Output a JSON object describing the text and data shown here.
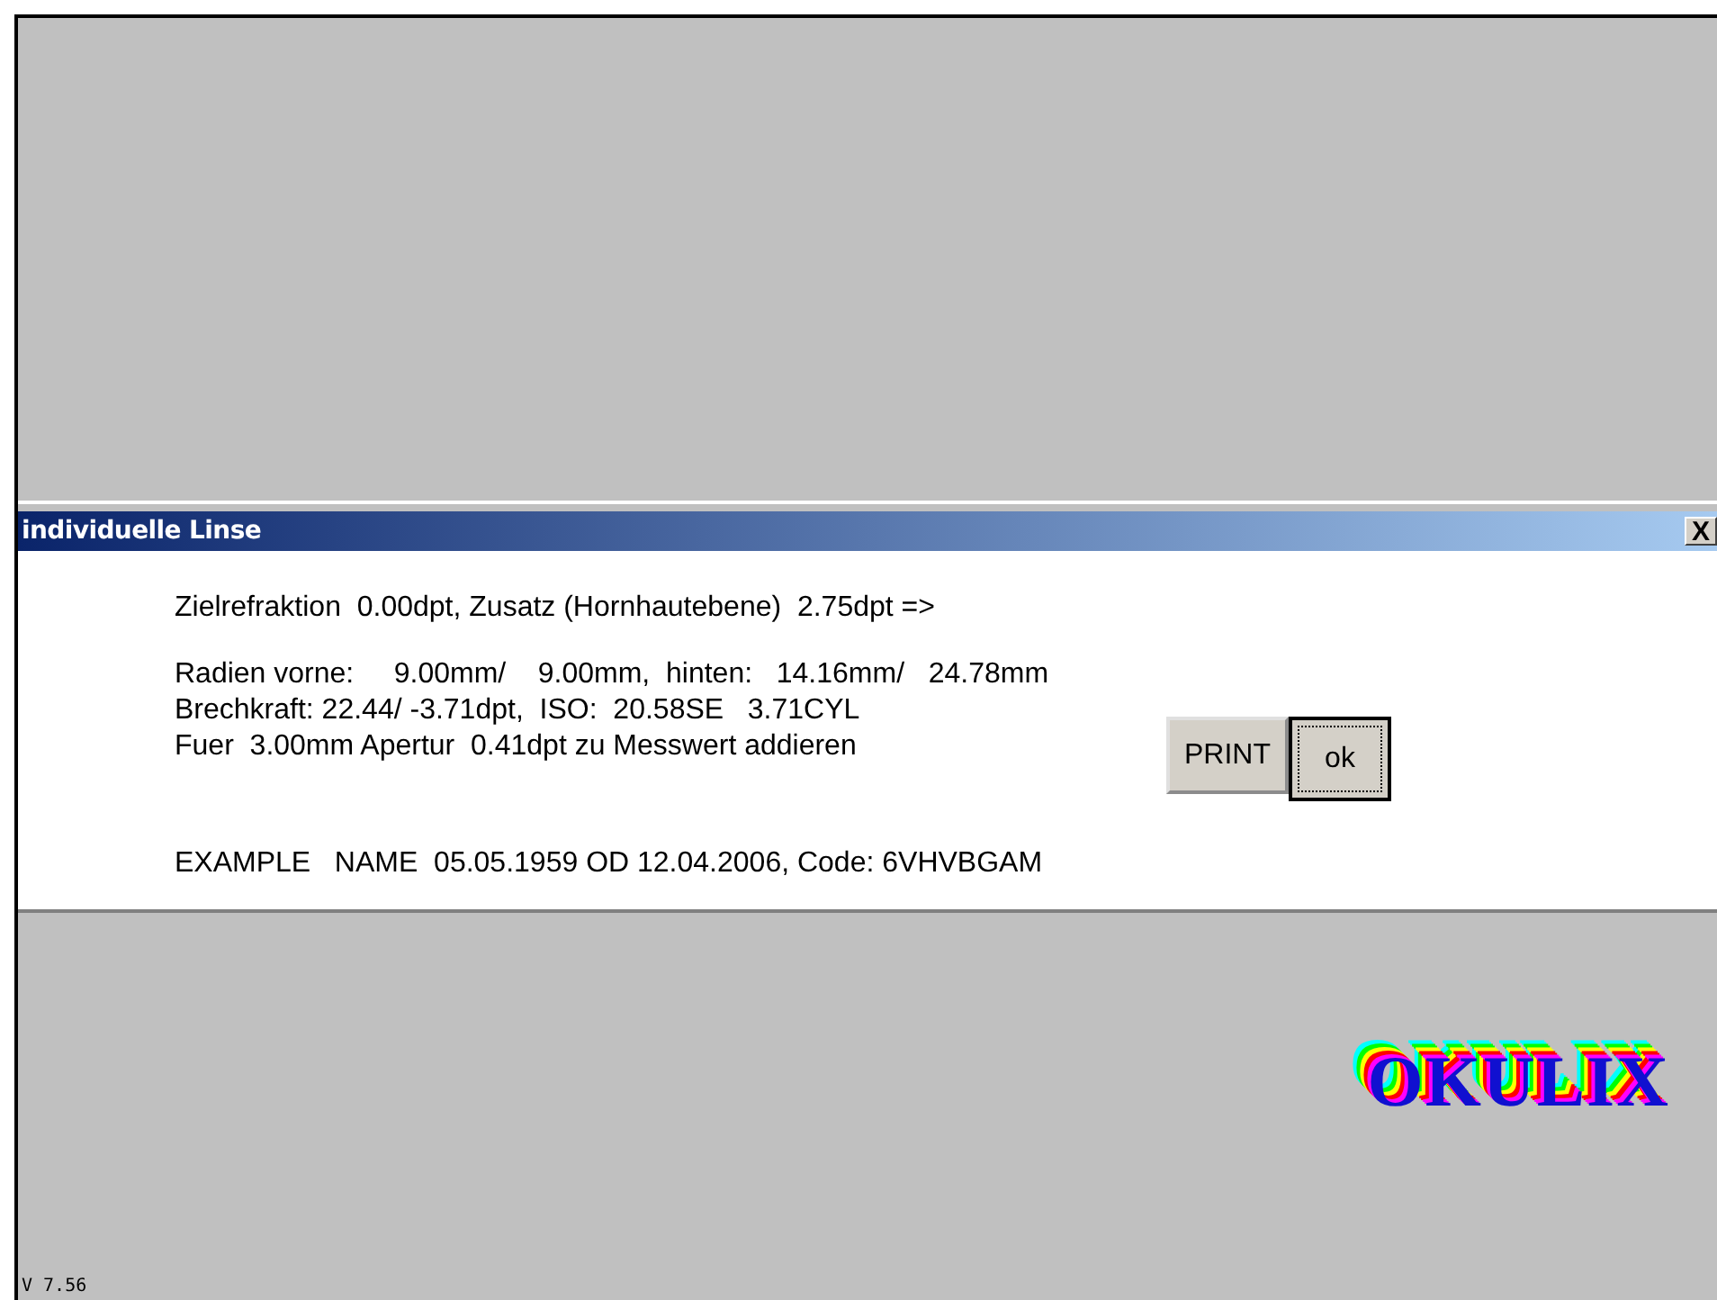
{
  "dialog": {
    "title": "individuelle Linse",
    "close": "X",
    "lines": [
      "Zielrefraktion  0.00dpt, Zusatz (Hornhautebene)  2.75dpt =>",
      "Radien vorne:     9.00mm/    9.00mm,  hinten:   14.16mm/   24.78mm",
      "Brechkraft: 22.44/ -3.71dpt,  ISO:  20.58SE   3.71CYL",
      "Fuer  3.00mm Apertur  0.41dpt zu Messwert addieren",
      "EXAMPLE   NAME  05.05.1959 OD 12.04.2006, Code: 6VHVBGAM"
    ],
    "buttons": [
      {
        "label": "PRINT",
        "focused": false
      },
      {
        "label": "ok",
        "focused": true
      }
    ]
  },
  "logo": "OKULIX",
  "version": "V 7.56"
}
